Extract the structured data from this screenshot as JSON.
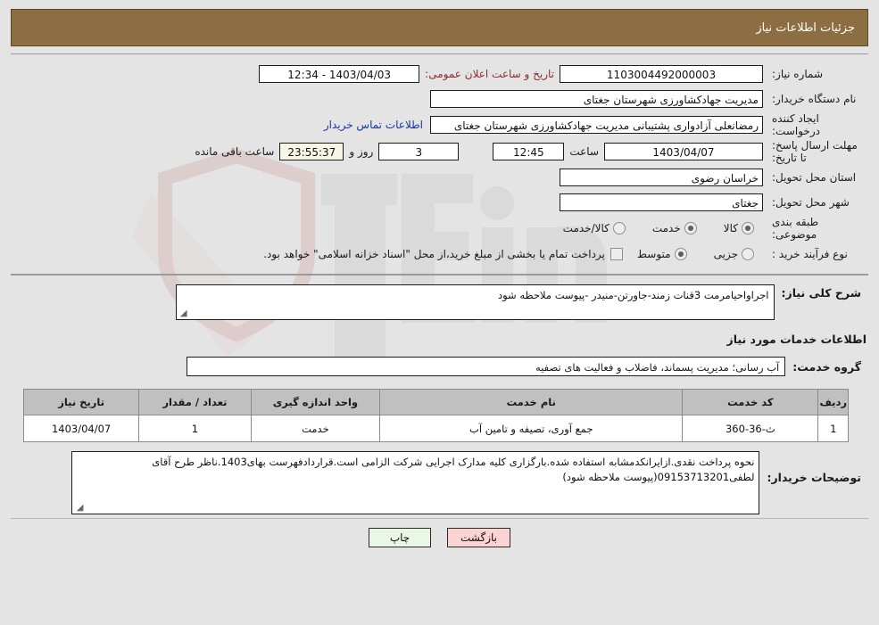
{
  "header": {
    "title": "جزئیات اطلاعات نیاز"
  },
  "info": {
    "need_number_label": "شماره نیاز:",
    "need_number": "1103004492000003",
    "buyer_org_label": "نام دستگاه خریدار:",
    "buyer_org": "مدیریت جهادکشاورزی شهرستان جغتای",
    "creator_label": "ایجاد کننده درخواست:",
    "creator": "رمضانعلی آزادواری پشتیبانی مدیریت جهادکشاورزی شهرستان جغتای",
    "contact_link": "اطلاعات تماس خریدار",
    "public_announce_label": "تاریخ و ساعت اعلان عمومی:",
    "public_announce_value": "1403/04/03 - 12:34",
    "deadline_label": "مهلت ارسال پاسخ: تا تاریخ:",
    "deadline_date": "1403/04/07",
    "deadline_hour_label": "ساعت",
    "deadline_time": "12:45",
    "remaining_days": "3",
    "remaining_days_label": "روز و",
    "remaining_countdown": "23:55:37",
    "remaining_suffix_label": "ساعت باقی مانده",
    "province_label": "استان محل تحویل:",
    "province": "خراسان رضوی",
    "city_label": "شهر محل تحویل:",
    "city": "جغتای",
    "category_label": "طبقه بندی موضوعی:",
    "category_options": [
      {
        "label": "کالا",
        "selected": false
      },
      {
        "label": "خدمت",
        "selected": true
      },
      {
        "label": "کالا/خدمت",
        "selected": false
      }
    ],
    "process_label": "نوع فرآیند خرید :",
    "process_options": [
      {
        "label": "جزیی",
        "selected": false
      },
      {
        "label": "متوسط",
        "selected": true
      }
    ],
    "treasury_checked": false,
    "treasury_note": "پرداخت تمام یا بخشی از مبلغ خرید،از محل \"اسناد خزانه اسلامی\" خواهد بود."
  },
  "detail": {
    "need_desc_label": "شرح کلی نیاز:",
    "need_desc": "اجراواحیامرمت 3قنات زمند-جاورتن-منیدر -پیوست ملاحظه شود",
    "services_section_title": "اطلاعات خدمات مورد نیاز",
    "service_group_label": "گروه خدمت:",
    "service_group": "آب رسانی؛ مدیریت پسماند، فاضلاب و فعالیت های تصفیه",
    "buyer_notes_label": "توضیحات خریدار:",
    "buyer_notes": "نحوه پرداخت نقدی.ازایرانکدمشابه استفاده شده.بارگزاری کلیه مدارک اجرایی شرکت الزامی است.قراردادفهرست بهای1403.ناظر طرح آقای لطفی09153713201(پیوست ملاحظه شود)"
  },
  "table": {
    "columns": [
      "ردیف",
      "کد خدمت",
      "نام خدمت",
      "واحد اندازه گیری",
      "تعداد / مقدار",
      "تاریخ نیاز"
    ],
    "rows": [
      {
        "row": "1",
        "code": "ث-36-360",
        "name": "جمع آوری، تصیفه و تامین آب",
        "unit": "خدمت",
        "qty": "1",
        "date": "1403/04/07"
      }
    ]
  },
  "footer": {
    "print_label": "چاپ",
    "back_label": "بازگشت"
  },
  "colors": {
    "header_bar": "#8c6e42",
    "page_bg": "#e4e4e4",
    "table_header": "#c0c0c0",
    "link": "#16399c",
    "red_label": "#8c2d2d",
    "print_btn": "#e9f7e4",
    "back_btn": "#fbd3d3",
    "countdown_bg": "#f7f5e3"
  },
  "watermark": {
    "text": "AriaTender.net"
  }
}
